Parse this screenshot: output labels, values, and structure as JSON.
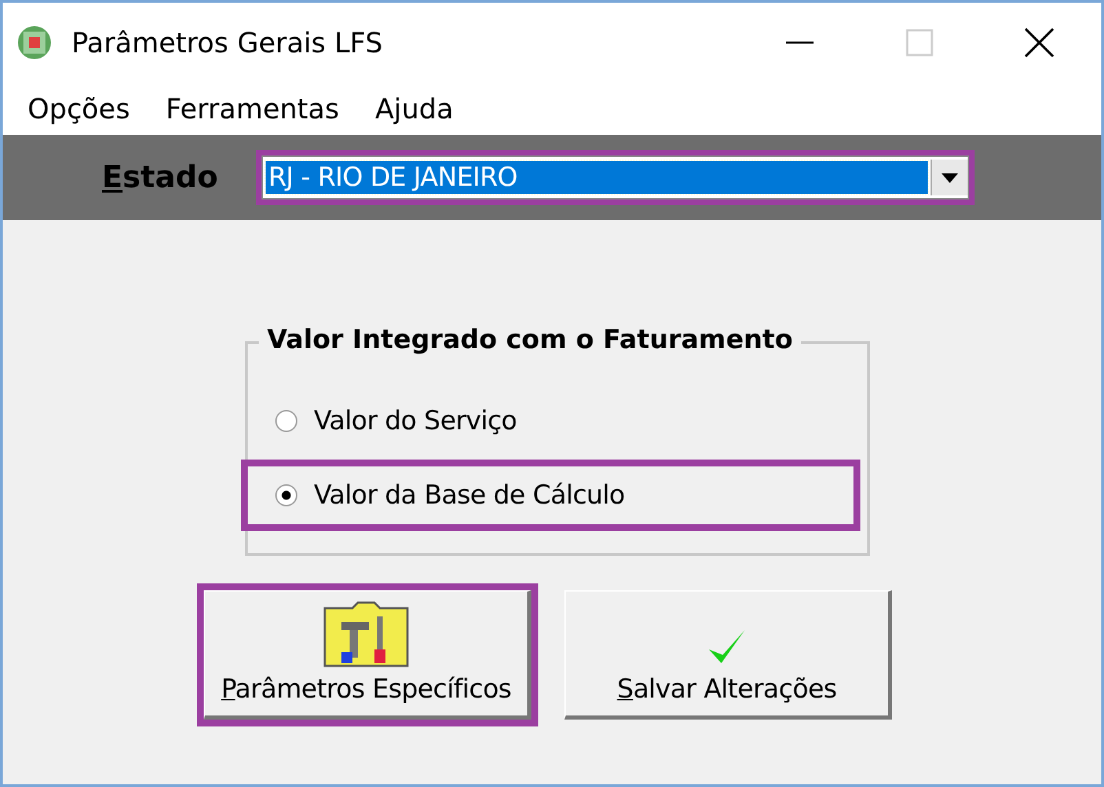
{
  "window": {
    "title": "Parâmetros Gerais LFS"
  },
  "menu": [
    {
      "label": "Opções"
    },
    {
      "label": "Ferramentas"
    },
    {
      "label": "Ajuda"
    }
  ],
  "estado": {
    "label": "Estado",
    "mnemonic": true,
    "value": "RJ - RIO DE JANEIRO",
    "highlighted": true
  },
  "group": {
    "title": "Valor Integrado com o Faturamento",
    "options": [
      {
        "label": "Valor do Serviço",
        "selected": false,
        "highlighted": false
      },
      {
        "label": "Valor da Base de Cálculo",
        "selected": true,
        "highlighted": true
      }
    ]
  },
  "buttons": [
    {
      "kind": "tools",
      "label": "Parâmetros Específicos",
      "mnemonic": true,
      "highlighted": true
    },
    {
      "kind": "check",
      "label": "Salvar Alterações",
      "mnemonic": true,
      "highlighted": false
    }
  ]
}
